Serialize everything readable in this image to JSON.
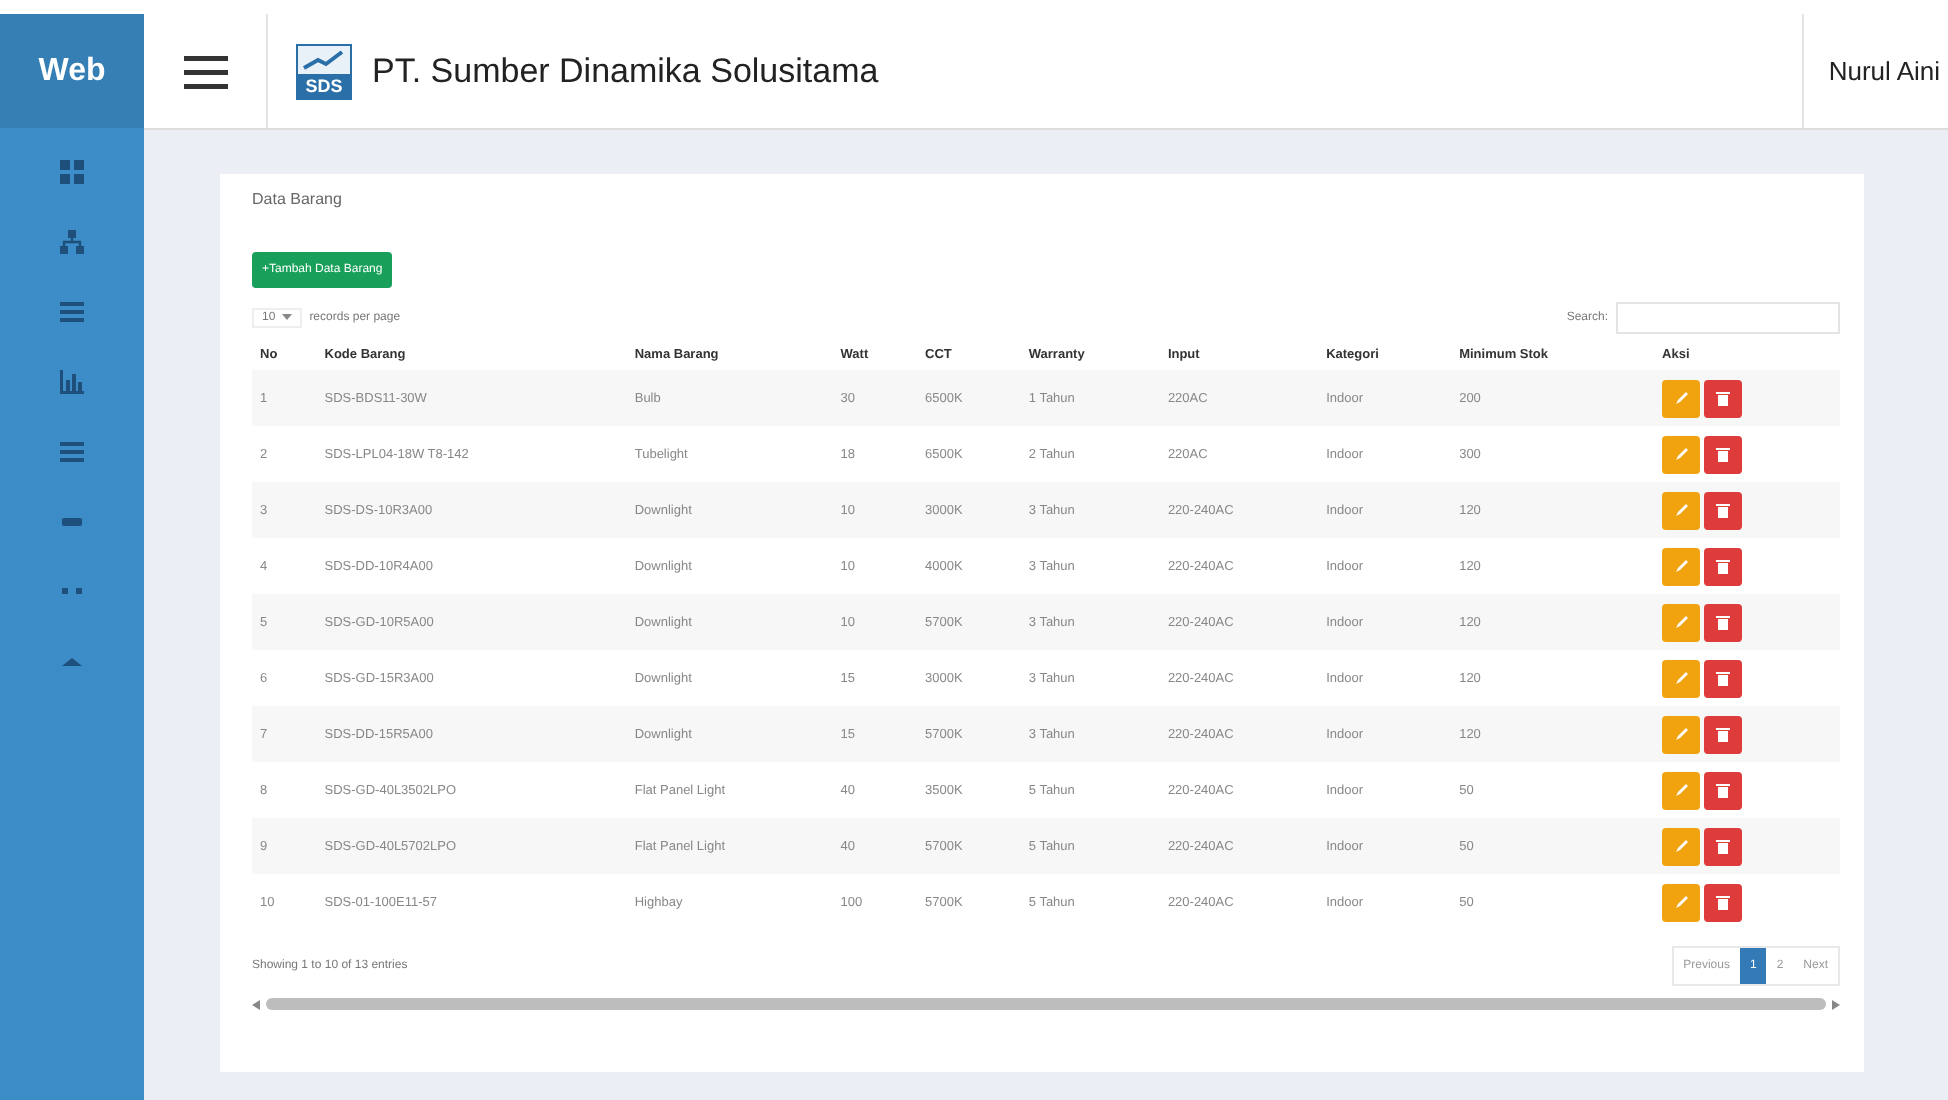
{
  "brand": "Web",
  "header": {
    "company": "PT. Sumber Dinamika Solusitama",
    "logo_text": "SDS",
    "user": "Nurul Aini"
  },
  "sidebar": {
    "items": [
      {
        "kind": "grid"
      },
      {
        "kind": "sitemap"
      },
      {
        "kind": "list"
      },
      {
        "kind": "chart"
      },
      {
        "kind": "list"
      },
      {
        "kind": "bar"
      },
      {
        "kind": "dots"
      },
      {
        "kind": "caret"
      }
    ]
  },
  "card": {
    "title": "Data Barang",
    "add_button": "+Tambah Data Barang",
    "page_size": "10",
    "page_size_label": "records per page",
    "search_label": "Search:",
    "table": {
      "columns": [
        "No",
        "Kode Barang",
        "Nama Barang",
        "Watt",
        "CCT",
        "Warranty",
        "Input",
        "Kategori",
        "Minimum Stok",
        "Aksi"
      ],
      "rows": [
        [
          "1",
          "SDS-BDS11-30W",
          "Bulb",
          "30",
          "6500K",
          "1 Tahun",
          "220AC",
          "Indoor",
          "200"
        ],
        [
          "2",
          "SDS-LPL04-18W T8-142",
          "Tubelight",
          "18",
          "6500K",
          "2 Tahun",
          "220AC",
          "Indoor",
          "300"
        ],
        [
          "3",
          "SDS-DS-10R3A00",
          "Downlight",
          "10",
          "3000K",
          "3 Tahun",
          "220-240AC",
          "Indoor",
          "120"
        ],
        [
          "4",
          "SDS-DD-10R4A00",
          "Downlight",
          "10",
          "4000K",
          "3 Tahun",
          "220-240AC",
          "Indoor",
          "120"
        ],
        [
          "5",
          "SDS-GD-10R5A00",
          "Downlight",
          "10",
          "5700K",
          "3 Tahun",
          "220-240AC",
          "Indoor",
          "120"
        ],
        [
          "6",
          "SDS-GD-15R3A00",
          "Downlight",
          "15",
          "3000K",
          "3 Tahun",
          "220-240AC",
          "Indoor",
          "120"
        ],
        [
          "7",
          "SDS-DD-15R5A00",
          "Downlight",
          "15",
          "5700K",
          "3 Tahun",
          "220-240AC",
          "Indoor",
          "120"
        ],
        [
          "8",
          "SDS-GD-40L3502LPO",
          "Flat Panel Light",
          "40",
          "3500K",
          "5 Tahun",
          "220-240AC",
          "Indoor",
          "50"
        ],
        [
          "9",
          "SDS-GD-40L5702LPO",
          "Flat Panel Light",
          "40",
          "5700K",
          "5 Tahun",
          "220-240AC",
          "Indoor",
          "50"
        ],
        [
          "10",
          "SDS-01-100E11-57",
          "Highbay",
          "100",
          "5700K",
          "5 Tahun",
          "220-240AC",
          "Indoor",
          "50"
        ]
      ]
    },
    "info": "Showing 1 to 10 of 13 entries",
    "pagination": [
      {
        "label": "Previous",
        "selected": false
      },
      {
        "label": "1",
        "selected": true
      },
      {
        "label": "2",
        "selected": false
      },
      {
        "label": "Next",
        "selected": false
      }
    ]
  }
}
